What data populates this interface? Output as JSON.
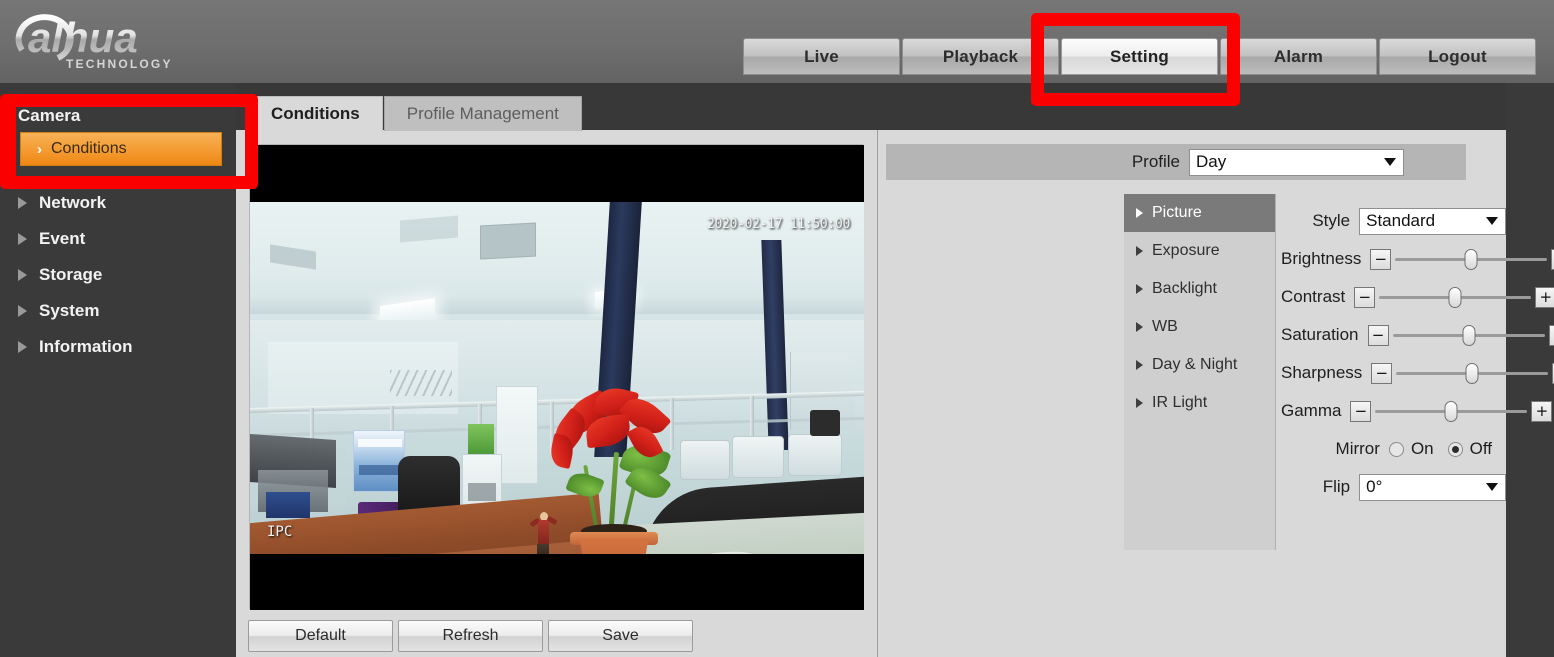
{
  "brand": {
    "name": "alhua",
    "tagline": "TECHNOLOGY"
  },
  "header": {
    "tabs": [
      {
        "label": "Live",
        "active": false
      },
      {
        "label": "Playback",
        "active": false
      },
      {
        "label": "Setting",
        "active": true
      },
      {
        "label": "Alarm",
        "active": false
      },
      {
        "label": "Logout",
        "active": false
      }
    ]
  },
  "sidebar": {
    "camera_label": "Camera",
    "camera_sub": {
      "label": "Conditions",
      "chevron": "›",
      "active": true
    },
    "groups": [
      {
        "label": "Network"
      },
      {
        "label": "Event"
      },
      {
        "label": "Storage"
      },
      {
        "label": "System"
      },
      {
        "label": "Information"
      }
    ]
  },
  "content_tabs": [
    {
      "label": "Conditions",
      "active": true
    },
    {
      "label": "Profile Management",
      "active": false
    }
  ],
  "video": {
    "timestamp": "2020-02-17 11:50:00",
    "channel": "IPC"
  },
  "actions": [
    {
      "label": "Default"
    },
    {
      "label": "Refresh"
    },
    {
      "label": "Save"
    }
  ],
  "settings": {
    "profile": {
      "label": "Profile",
      "value": "Day"
    },
    "submenu": [
      {
        "label": "Picture",
        "active": true
      },
      {
        "label": "Exposure",
        "active": false
      },
      {
        "label": "Backlight",
        "active": false
      },
      {
        "label": "WB",
        "active": false
      },
      {
        "label": "Day & Night",
        "active": false
      },
      {
        "label": "IR Light",
        "active": false
      }
    ],
    "style": {
      "label": "Style",
      "value": "Standard"
    },
    "sliders": [
      {
        "label": "Brightness",
        "value": "50",
        "minus": "−",
        "plus": "+"
      },
      {
        "label": "Contrast",
        "value": "50",
        "minus": "−",
        "plus": "+"
      },
      {
        "label": "Saturation",
        "value": "50",
        "minus": "−",
        "plus": "+"
      },
      {
        "label": "Sharpness",
        "value": "50",
        "minus": "−",
        "plus": "+"
      },
      {
        "label": "Gamma",
        "value": "50",
        "minus": "−",
        "plus": "+"
      }
    ],
    "mirror": {
      "label": "Mirror",
      "on_label": "On",
      "off_label": "Off",
      "selected": "Off"
    },
    "flip": {
      "label": "Flip",
      "value": "0°"
    }
  },
  "colors": {
    "accent_orange": "#f49c33",
    "annotation_red": "#fb0000",
    "header_grey": "#6e6e6e",
    "sidebar_dark": "#3a3a3a",
    "panel_grey": "#d9d9d9"
  }
}
